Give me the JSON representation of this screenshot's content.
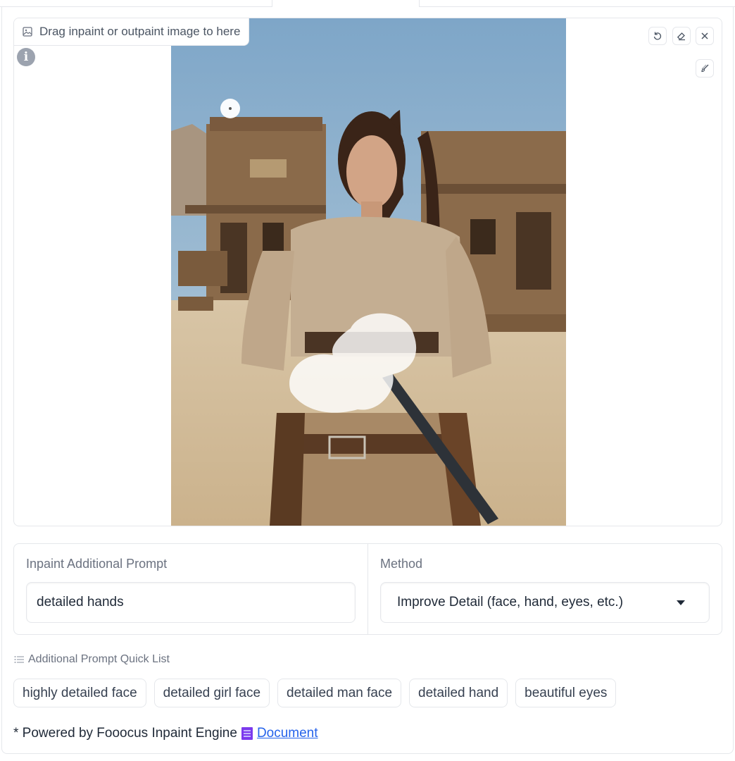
{
  "canvas": {
    "drop_label": "Drag inpaint or outpaint image to here",
    "info_symbol": "i",
    "tools": [
      "undo-icon",
      "eraser-icon",
      "close-icon",
      "brush-icon"
    ]
  },
  "inpaint_prompt": {
    "label": "Inpaint Additional Prompt",
    "value": "detailed hands"
  },
  "method": {
    "label": "Method",
    "selected": "Improve Detail (face, hand, eyes, etc.)"
  },
  "quick_list": {
    "title": "Additional Prompt Quick List",
    "items": [
      "highly detailed face",
      "detailed girl face",
      "detailed man face",
      "detailed hand",
      "beautiful eyes"
    ]
  },
  "footer": {
    "text": "* Powered by Fooocus Inpaint Engine",
    "link_text": "Document"
  },
  "colors": {
    "accent_link": "#2563eb",
    "border": "#e5e7eb",
    "label_gray": "#6b7280"
  }
}
